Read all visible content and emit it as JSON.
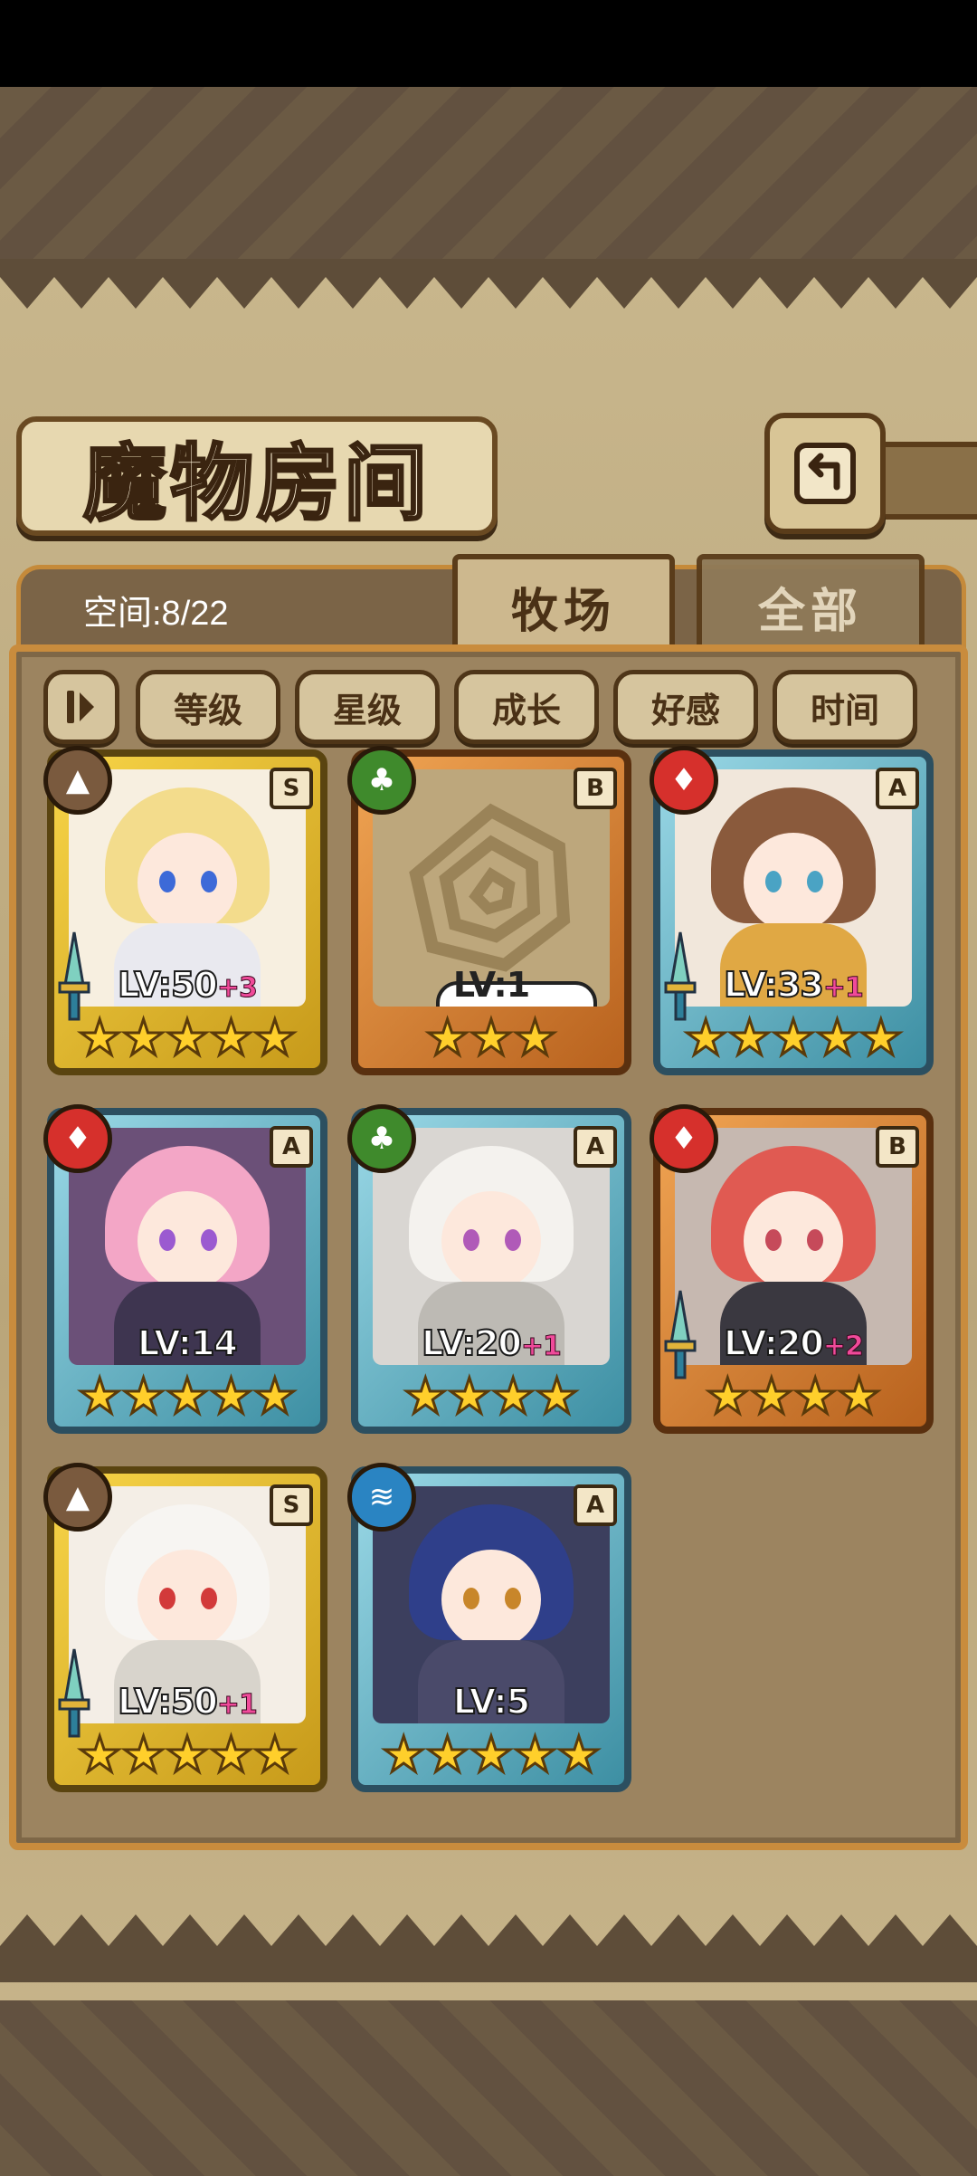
{
  "title": "魔物房间",
  "space": "空间:8/22",
  "tabs": [
    {
      "label": "牧场",
      "active": true
    },
    {
      "label": "全部",
      "active": false
    }
  ],
  "filters": [
    "等级",
    "星级",
    "成长",
    "好感",
    "时间"
  ],
  "colors": {
    "grade_S": "#f7d447",
    "grade_A": "#7fc6d6",
    "grade_B": "#e58f3c",
    "level_bonus": "#f04a9a",
    "star": "#ffcf2b"
  },
  "cards": [
    {
      "grade": "S",
      "element": "earth-icon",
      "level": "LV:50",
      "bonus": "+3",
      "stars": "★★★★★",
      "equip": true
    },
    {
      "grade": "B",
      "element": "leaf-icon",
      "level": "LV:1",
      "bonus": "",
      "stars": "★★★",
      "equip": false,
      "egg": true
    },
    {
      "grade": "A",
      "element": "fire-icon",
      "level": "LV:33",
      "bonus": "+1",
      "stars": "★★★★★",
      "equip": true
    },
    {
      "grade": "A",
      "element": "fire-icon",
      "level": "LV:14",
      "bonus": "",
      "stars": "★★★★★",
      "equip": false
    },
    {
      "grade": "A",
      "element": "leaf-icon",
      "level": "LV:20",
      "bonus": "+1",
      "stars": "★★★★",
      "equip": false
    },
    {
      "grade": "B",
      "element": "fire-icon",
      "level": "LV:20",
      "bonus": "+2",
      "stars": "★★★★",
      "equip": true
    },
    {
      "grade": "S",
      "element": "earth-icon",
      "level": "LV:50",
      "bonus": "+1",
      "stars": "★★★★★",
      "equip": true
    },
    {
      "grade": "A",
      "element": "water-icon",
      "level": "LV:5",
      "bonus": "",
      "stars": "★★★★★",
      "equip": false
    }
  ]
}
